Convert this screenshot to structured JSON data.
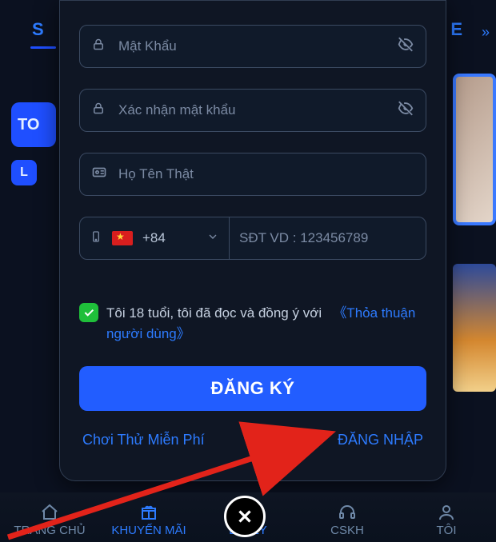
{
  "bg": {
    "s": "S",
    "e": "E",
    "to": "TO",
    "l": "L"
  },
  "form": {
    "password": {
      "placeholder": "Mật Khẩu"
    },
    "confirm": {
      "placeholder": "Xác nhận mật khẩu"
    },
    "realname": {
      "placeholder": "Họ Tên Thật"
    },
    "phone": {
      "country_code": "+84",
      "placeholder": "SĐT VD : 123456789"
    },
    "agree": {
      "text": "Tôi 18 tuổi, tôi đã đọc và đồng ý với",
      "link": "《Thỏa thuận người dùng》"
    },
    "submit": "ĐĂNG KÝ",
    "try_free": "Chơi Thử Miễn Phí",
    "login": "ĐĂNG NHẬP"
  },
  "nav": {
    "home": "TRANG CHỦ",
    "promo": "KHUYẾN MÃI",
    "agent": "ĐẠI LÝ",
    "support": "CSKH",
    "me": "TÔI"
  }
}
